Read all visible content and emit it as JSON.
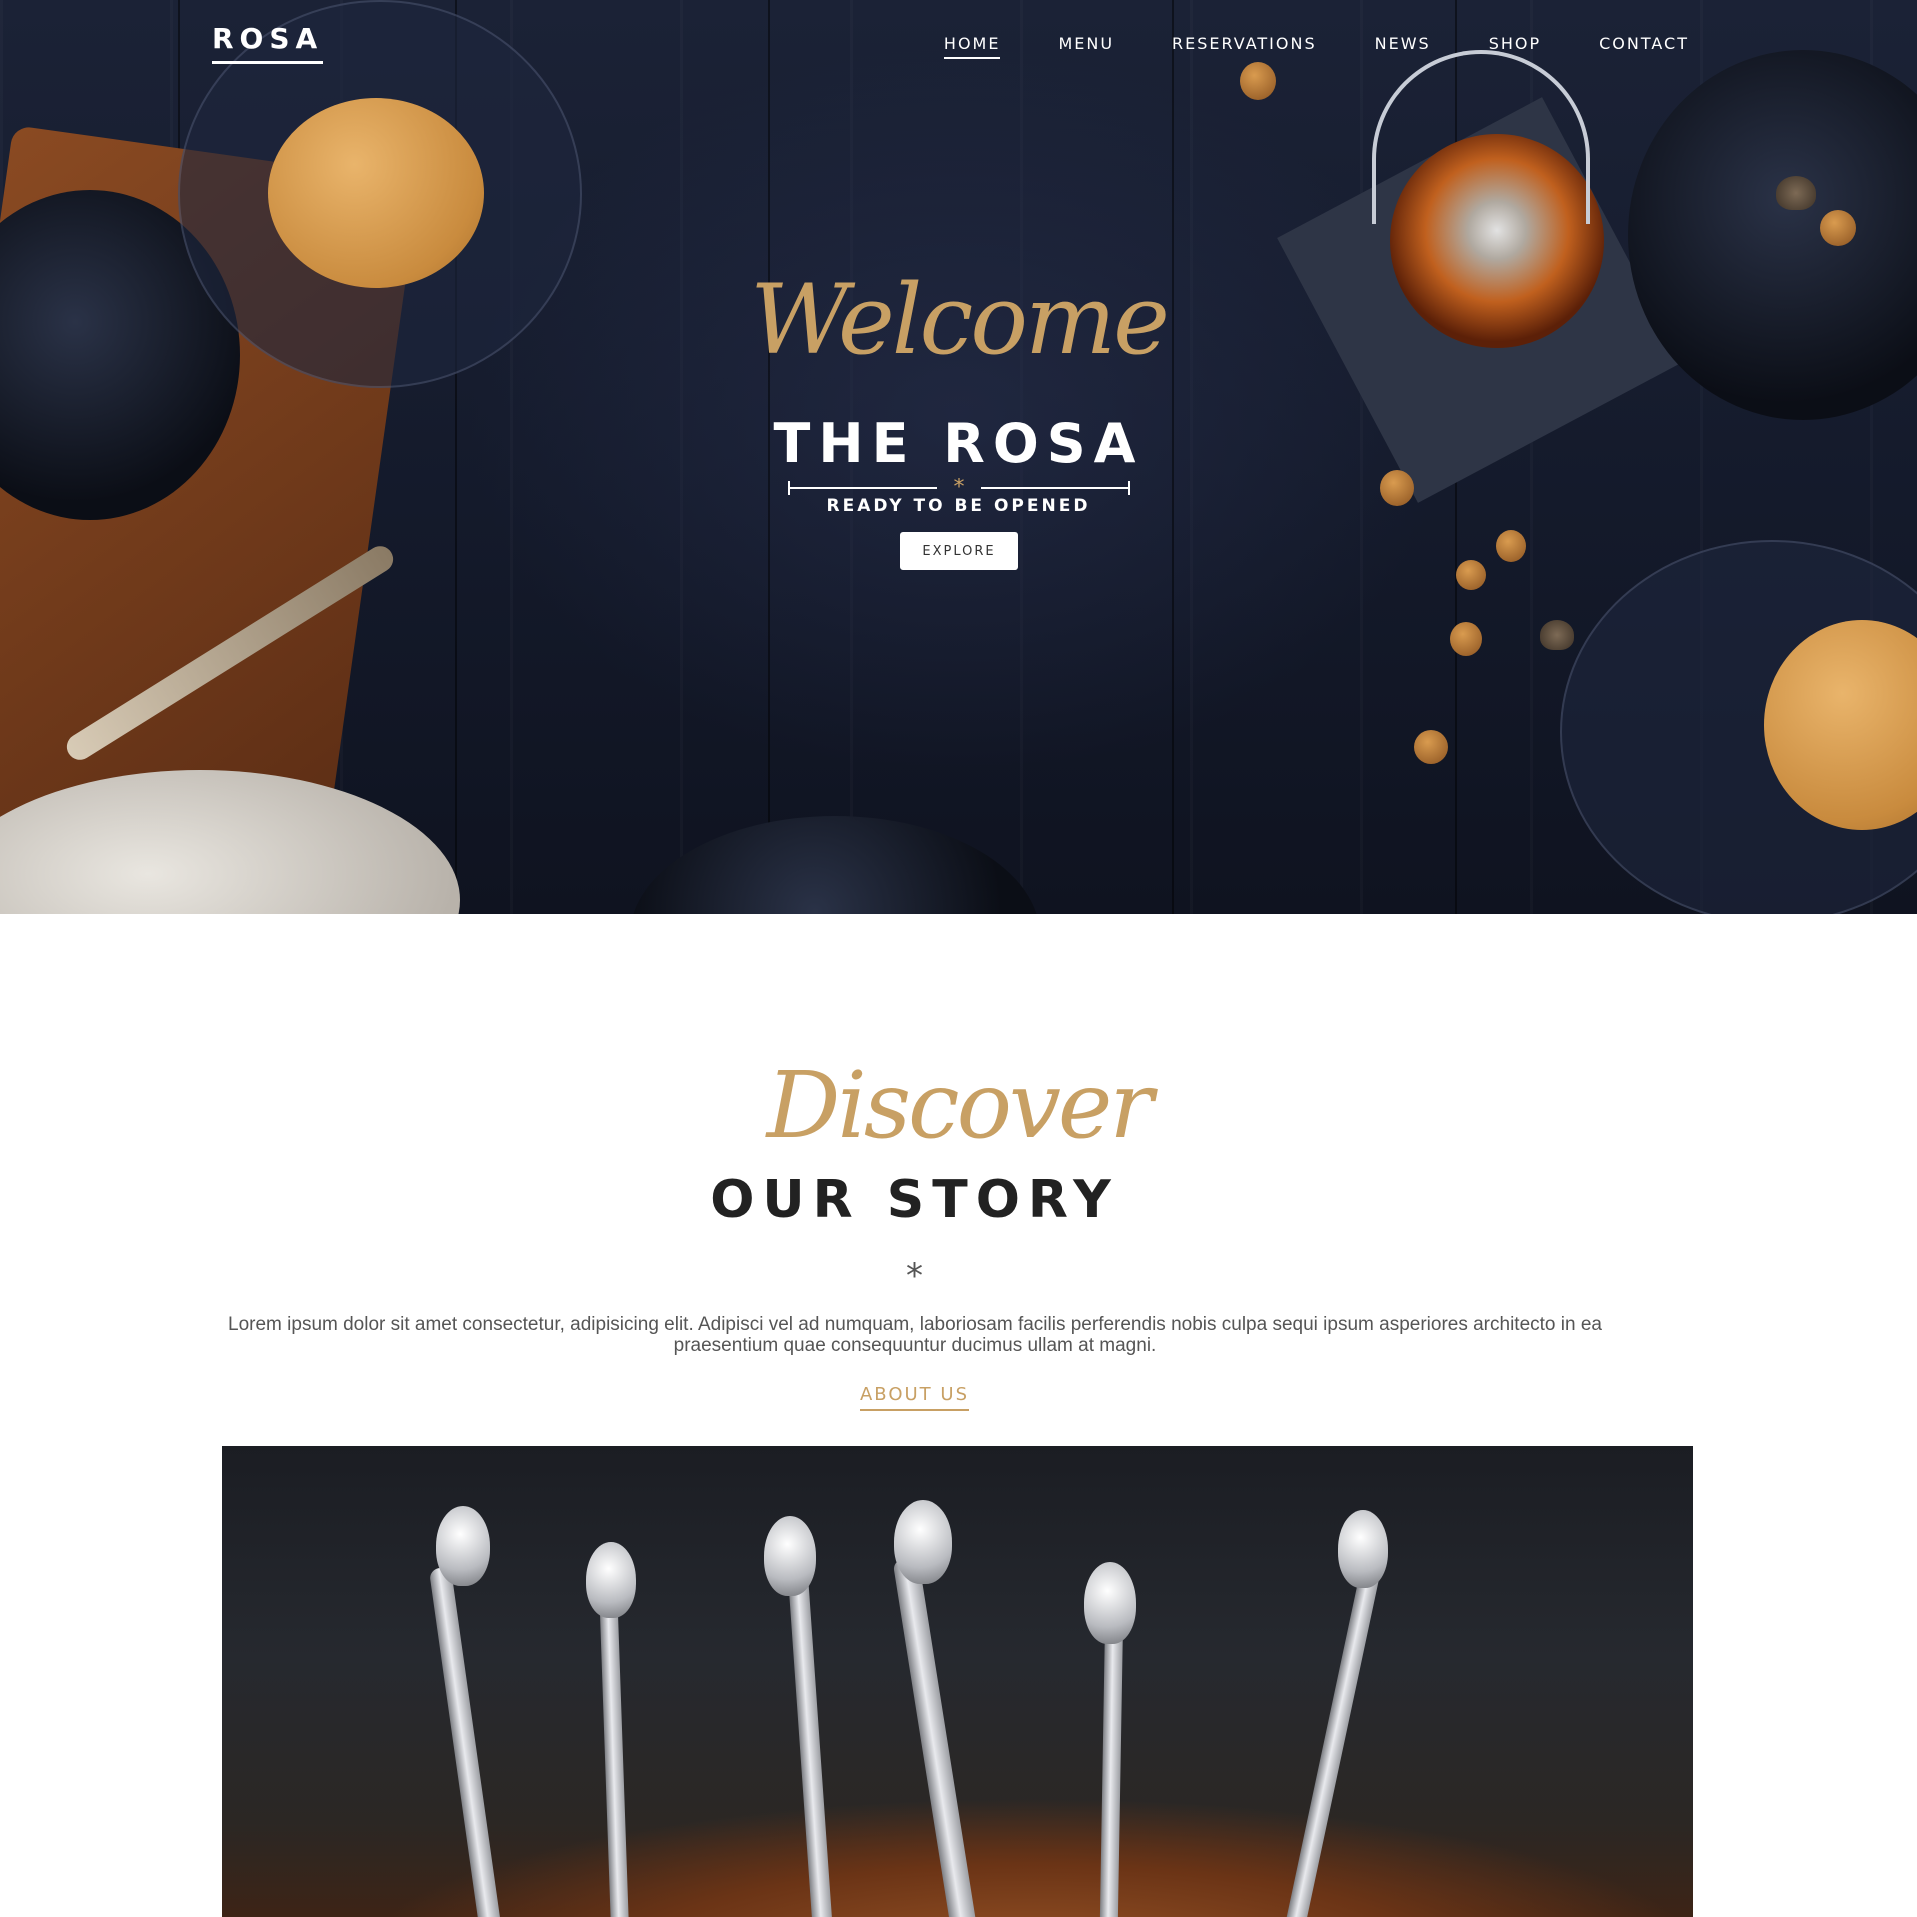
{
  "brand": {
    "logo": "ROSA"
  },
  "nav": {
    "items": [
      {
        "label": "HOME",
        "active": true
      },
      {
        "label": "MENU",
        "active": false
      },
      {
        "label": "RESERVATIONS",
        "active": false
      },
      {
        "label": "NEWS",
        "active": false
      },
      {
        "label": "SHOP",
        "active": false
      },
      {
        "label": "CONTACT",
        "active": false
      }
    ]
  },
  "hero": {
    "script": "Welcome",
    "title": "THE ROSA",
    "subtitle": "READY TO BE OPENED",
    "divider_glyph": "*",
    "cta": "EXPLORE"
  },
  "story": {
    "script": "Discover",
    "title": "OUR STORY",
    "asterisk": "*",
    "body": "Lorem ipsum dolor sit amet consectetur, adipisicing elit. Adipisci vel ad numquam, laboriosam facilis perferendis nobis culpa sequi ipsum asperiores architecto in ea praesentium quae consequuntur ducimus ullam at magni.",
    "link": "ABOUT US"
  },
  "colors": {
    "accent": "#c8a064",
    "hero_bg": "#161c2d",
    "heading": "#222222",
    "body_text": "#555555"
  },
  "icons": {
    "divider": "asterisk-divider-icon"
  }
}
